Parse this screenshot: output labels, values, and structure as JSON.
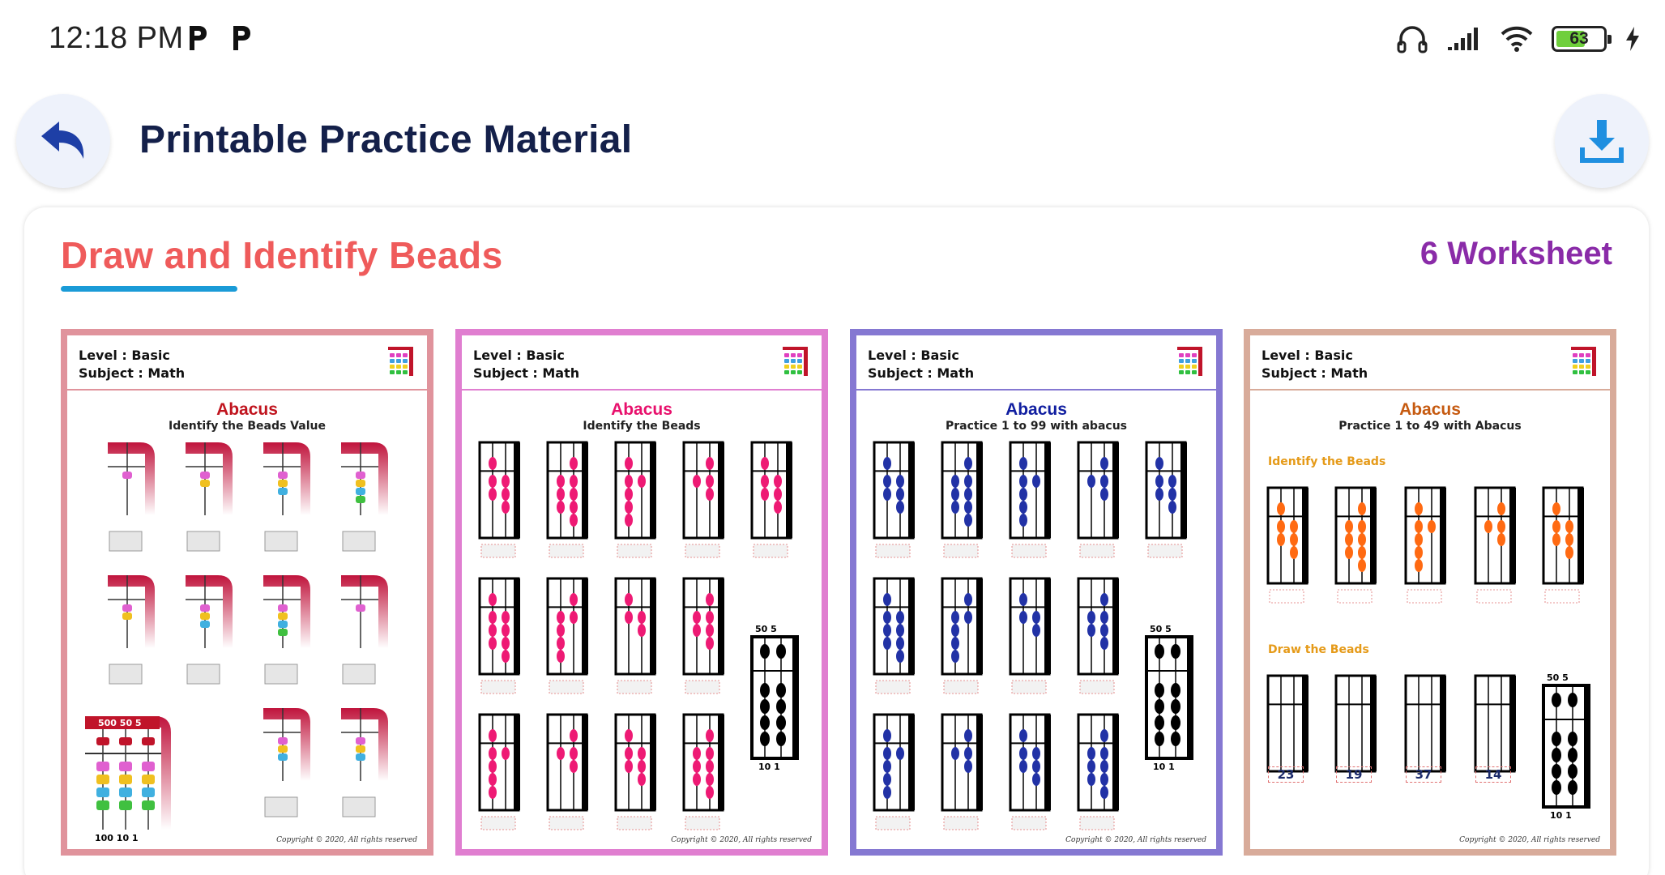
{
  "status_bar": {
    "time": "12:18 PM",
    "battery": "63",
    "battery_level": 0.63
  },
  "header": {
    "back_icon": "back-arrow-icon",
    "title": "Printable Practice Material",
    "download_icon": "download-icon"
  },
  "section": {
    "title": "Draw and Identify Beads",
    "count": "6 Worksheet"
  },
  "worksheets": [
    {
      "level": "Level : Basic",
      "subject": "Subject : Math",
      "title": "Abacus",
      "subtitle": "Identify the Beads Value",
      "border_color": "#e0939c",
      "title_color": "#c0141e",
      "copyright": "Copyright © 2020, All rights reserved",
      "big_abacus_top": "500  50   5",
      "big_abacus_bottom": "100  10   1"
    },
    {
      "level": "Level : Basic",
      "subject": "Subject : Math",
      "title": "Abacus",
      "subtitle": "Identify the Beads",
      "border_color": "#e07ed0",
      "title_color": "#e8106c",
      "bead_color": "#ee1a74",
      "copyright": "Copyright © 2020, All rights reserved",
      "abacus_top": "50   5",
      "abacus_bottom": "10   1"
    },
    {
      "level": "Level : Basic",
      "subject": "Subject : Math",
      "title": "Abacus",
      "subtitle": "Practice 1 to 99 with abacus",
      "border_color": "#8578d2",
      "title_color": "#101ea0",
      "bead_color": "#2232a6",
      "copyright": "Copyright © 2020, All rights reserved",
      "abacus_top": "50   5",
      "abacus_bottom": "10   1"
    },
    {
      "level": "Level : Basic",
      "subject": "Subject : Math",
      "title": "Abacus",
      "subtitle": "Practice 1 to 49 with Abacus",
      "border_color": "#d8ab9a",
      "title_color": "#c65a10",
      "bead_color": "#ff6a12",
      "section1": "Identify the Beads",
      "section2": "Draw the Beads",
      "numbers": [
        "23",
        "19",
        "37",
        "14"
      ],
      "copyright": "Copyright © 2020, All rights reserved",
      "abacus_top": "50   5",
      "abacus_bottom": "10   1"
    }
  ]
}
